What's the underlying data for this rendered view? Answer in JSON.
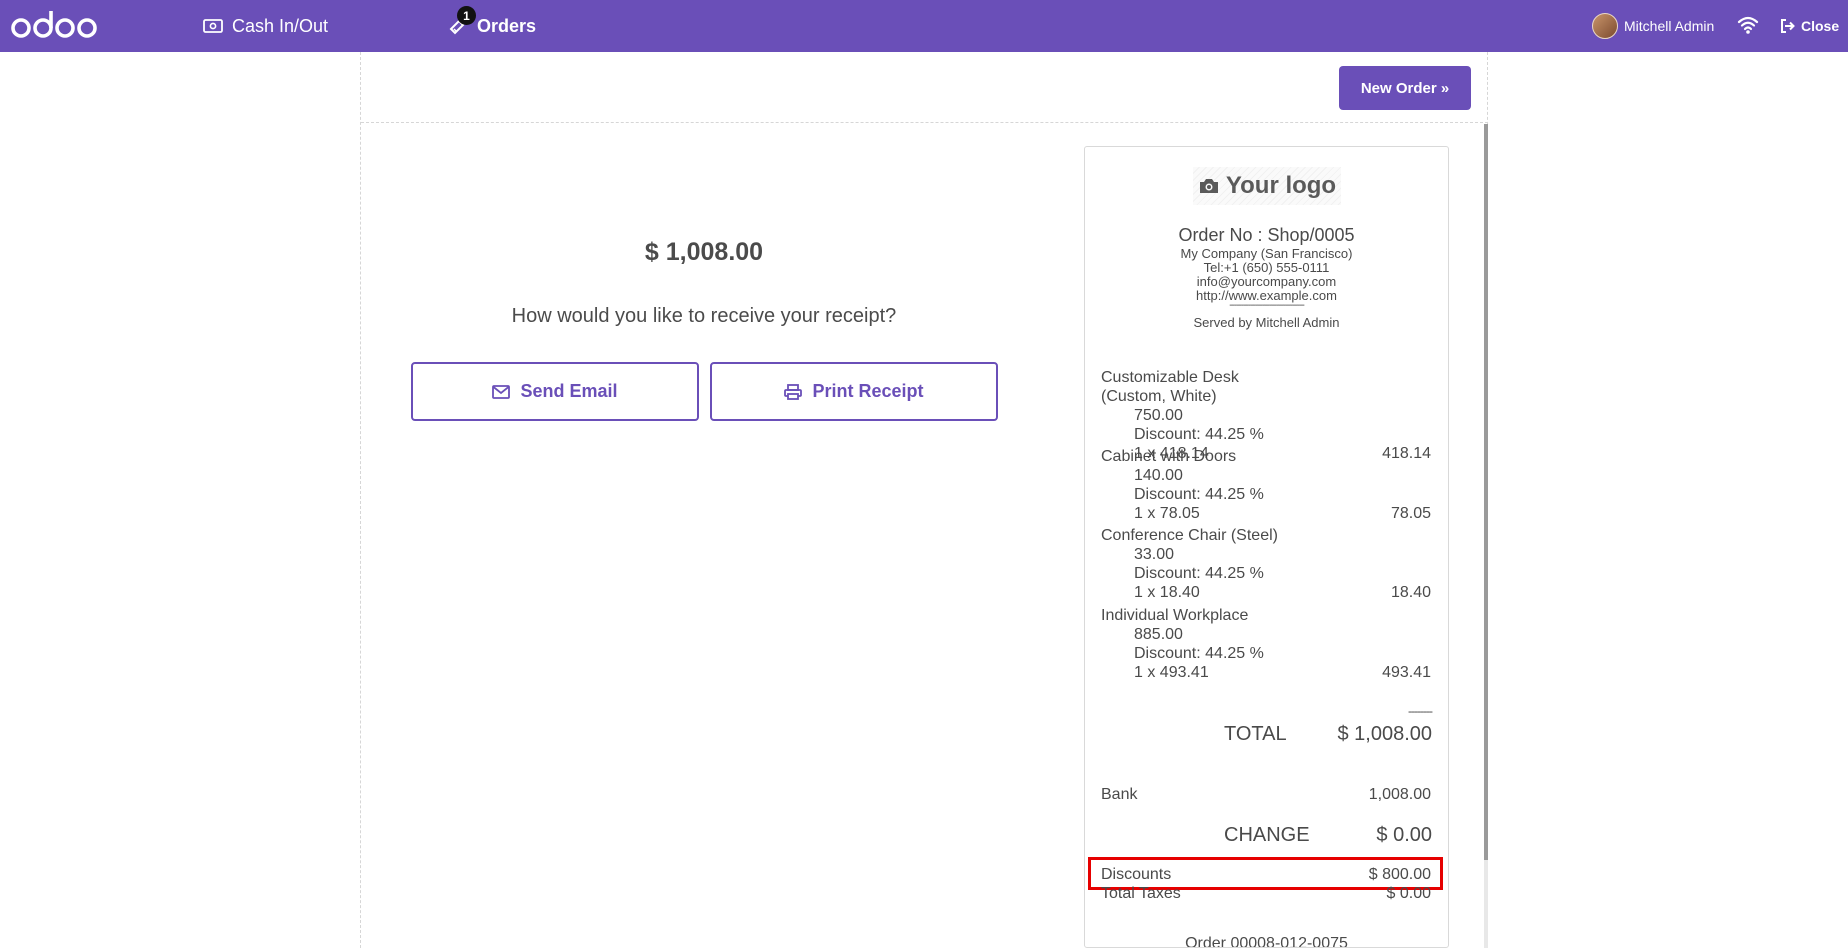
{
  "navbar": {
    "cash_label": "Cash In/Out",
    "orders_label": "Orders",
    "orders_badge": "1",
    "user_name": "Mitchell Admin",
    "close_label": "Close",
    "bg_color": "#6a4fb8"
  },
  "screen": {
    "new_order_label": "New Order »",
    "amount": "$ 1,008.00",
    "question": "How would you like to receive your receipt?",
    "send_email_label": "Send Email",
    "print_receipt_label": "Print Receipt"
  },
  "receipt": {
    "logo_text": "Your logo",
    "order_no": "Order No : Shop/0005",
    "company": "My Company (San Francisco)",
    "tel": "Tel:+1 (650) 555-0111",
    "email": "info@yourcompany.com",
    "website": "http://www.example.com",
    "separator": "--------------------------------",
    "served_by": "Served by Mitchell Admin",
    "lines": [
      {
        "name1": "Customizable Desk",
        "name2": "(Custom, White)",
        "price": "750.00",
        "discount": "Discount: 44.25 %",
        "qty": "1 x 418.14",
        "total": "418.14"
      },
      {
        "name1": "Cabinet with Doors",
        "price": "140.00",
        "discount": "Discount: 44.25 %",
        "qty": "1 x 78.05",
        "total": "78.05"
      },
      {
        "name1": "Conference Chair (Steel)",
        "price": "33.00",
        "discount": "Discount: 44.25 %",
        "qty": "1 x 18.40",
        "total": "18.40"
      },
      {
        "name1": "Individual Workplace",
        "price": "885.00",
        "discount": "Discount: 44.25 %",
        "qty": "1 x 493.41",
        "total": "493.41"
      }
    ],
    "sep_short": "--------",
    "total_label": "TOTAL",
    "total_value": "$ 1,008.00",
    "bank_label": "Bank",
    "bank_value": "1,008.00",
    "change_label": "CHANGE",
    "change_value": "$ 0.00",
    "discounts_label": "Discounts",
    "discounts_value": "$ 800.00",
    "taxes_label": "Total Taxes",
    "taxes_value": "$ 0.00",
    "order_ref": "Order 00008-012-0075"
  }
}
